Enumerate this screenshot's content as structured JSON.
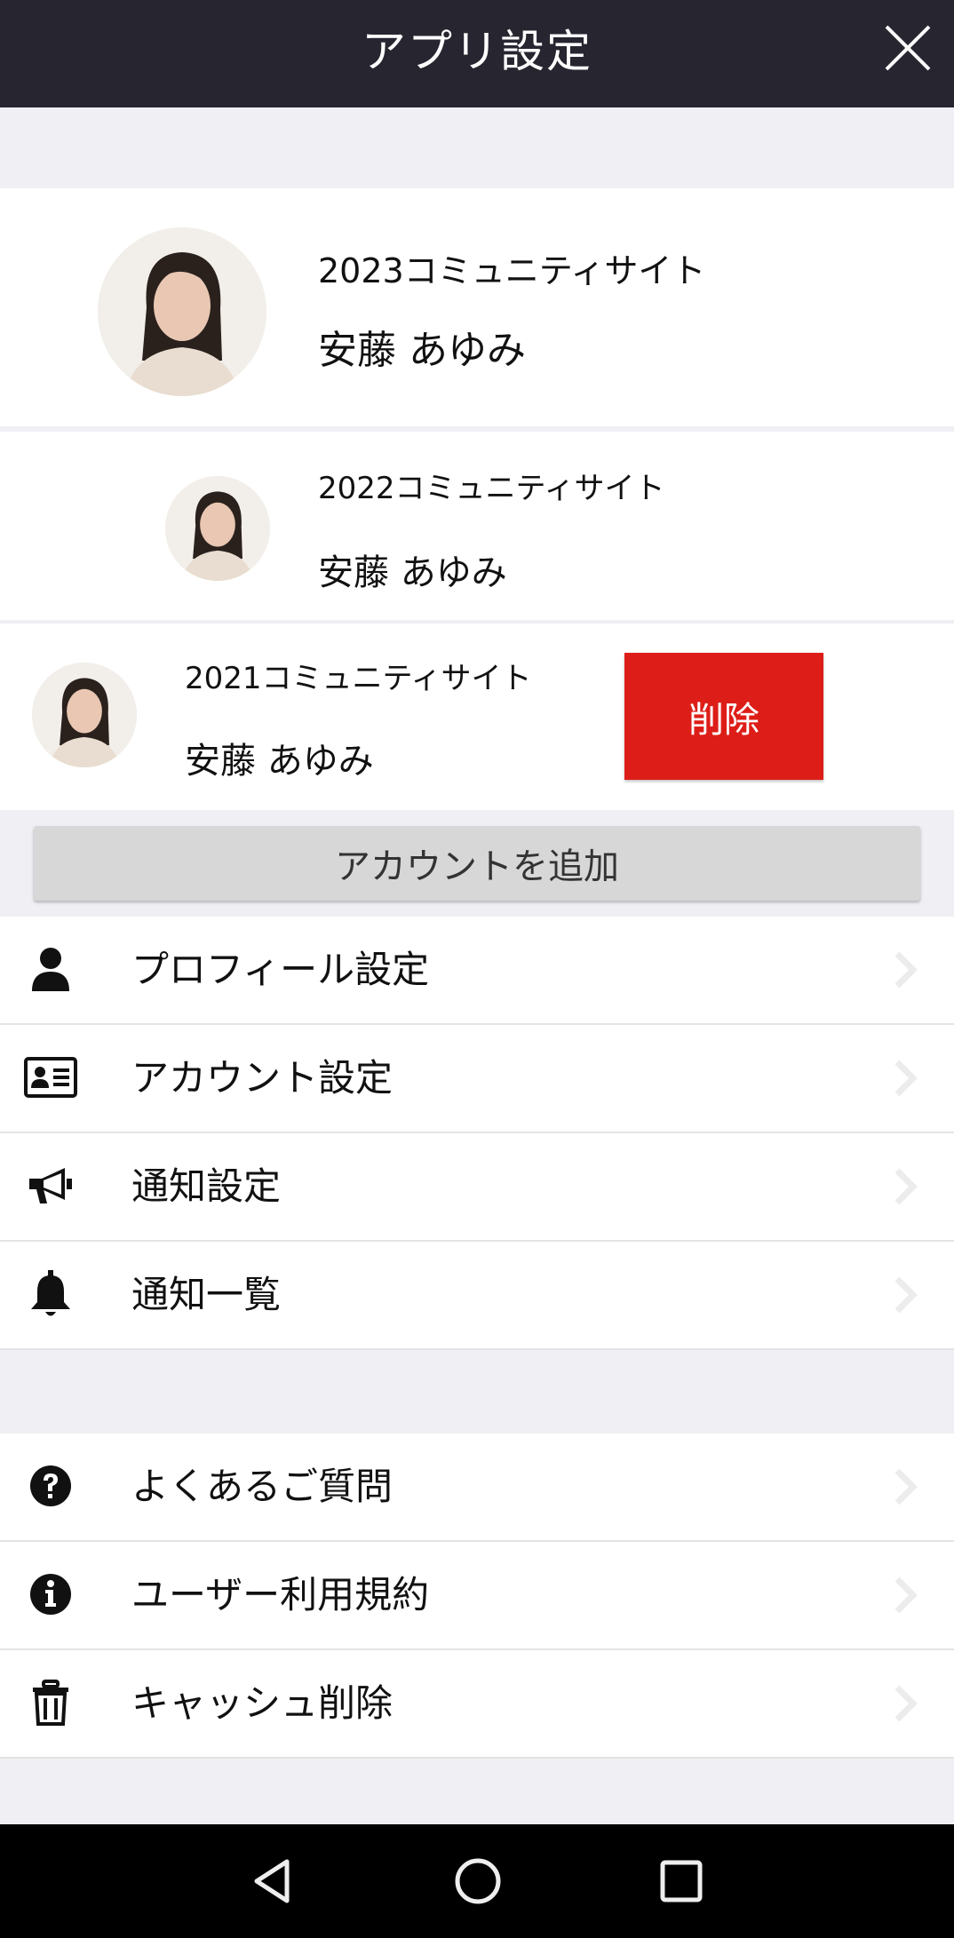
{
  "header": {
    "title": "アプリ設定",
    "close_icon": "close-icon"
  },
  "accounts": [
    {
      "site": "2023コミュニティサイト",
      "name": "安藤 あゆみ"
    },
    {
      "site": "2022コミュニティサイト",
      "name": "安藤 あゆみ"
    },
    {
      "site": "2021コミュニティサイト",
      "name": "安藤 あゆみ",
      "delete_label": "削除"
    }
  ],
  "add_account_label": "アカウントを追加",
  "menu_primary": [
    {
      "label": "プロフィール設定",
      "icon": "user-icon"
    },
    {
      "label": "アカウント設定",
      "icon": "id-card-icon"
    },
    {
      "label": "通知設定",
      "icon": "megaphone-icon"
    },
    {
      "label": "通知一覧",
      "icon": "bell-icon"
    }
  ],
  "menu_secondary": [
    {
      "label": "よくあるご質問",
      "icon": "question-circle-icon"
    },
    {
      "label": "ユーザー利用規約",
      "icon": "info-circle-icon"
    },
    {
      "label": "キャッシュ削除",
      "icon": "trash-icon"
    }
  ],
  "colors": {
    "header_bg": "#262530",
    "delete_red": "#dd1e18",
    "page_bg": "#efeff4"
  },
  "navbar": {
    "back": "back-icon",
    "home": "home-icon",
    "recents": "recents-icon"
  }
}
